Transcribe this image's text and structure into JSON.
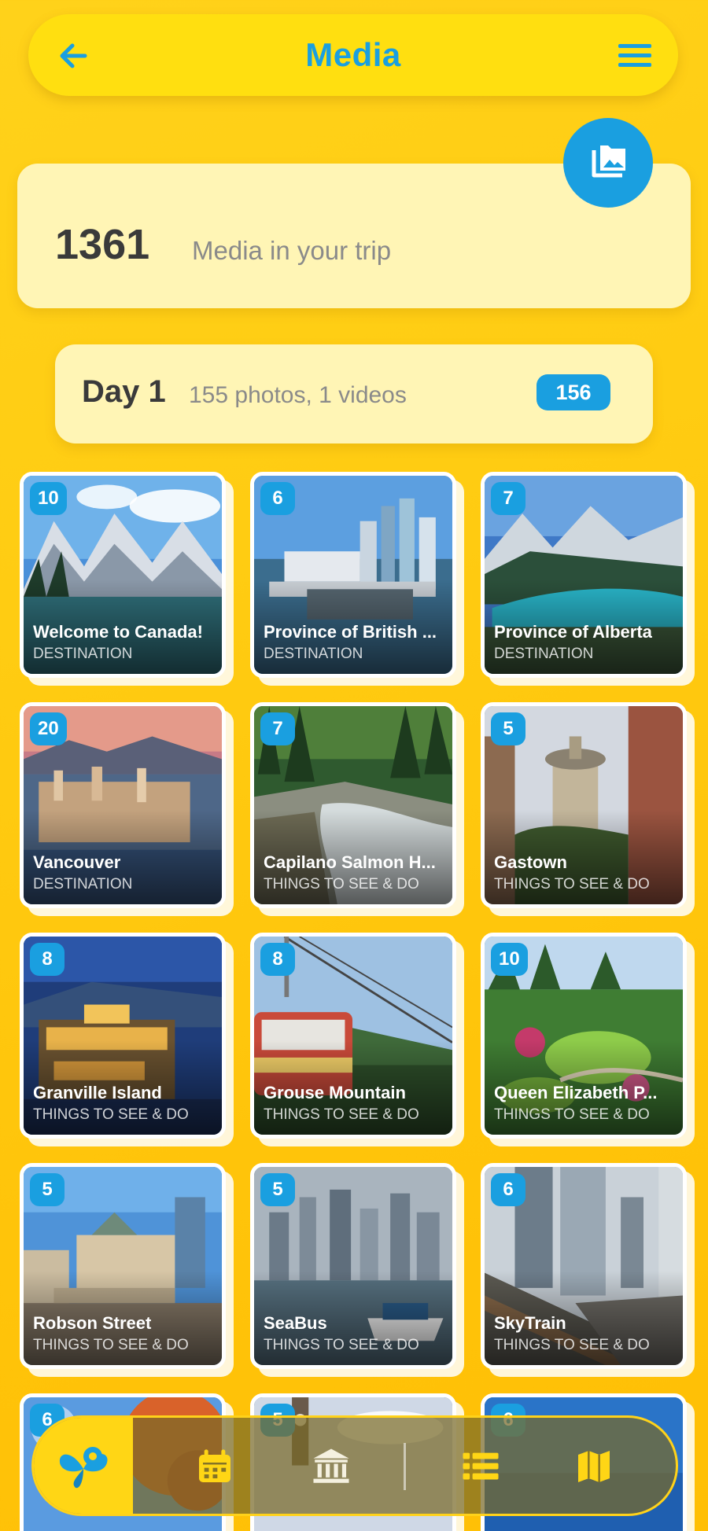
{
  "header": {
    "title": "Media"
  },
  "summary": {
    "count": "1361",
    "label": "Media in your trip"
  },
  "day": {
    "title": "Day 1",
    "subtitle": "155 photos, 1 videos",
    "badge": "156"
  },
  "colors": {
    "accent": "#1a9fe0",
    "header_bg": "#ffdf10",
    "card_bg": "#fff5b5",
    "page_bg": "#ffcc12"
  },
  "tiles": [
    {
      "count": "10",
      "name": "Welcome to Canada!",
      "category": "DESTINATION",
      "scene": "mountain-lake"
    },
    {
      "count": "6",
      "name": "Province of British ...",
      "category": "DESTINATION",
      "scene": "city-harbor"
    },
    {
      "count": "7",
      "name": "Province of Alberta",
      "category": "DESTINATION",
      "scene": "turquoise-lake"
    },
    {
      "count": "20",
      "name": "Vancouver",
      "category": "DESTINATION",
      "scene": "city-sunset"
    },
    {
      "count": "7",
      "name": "Capilano Salmon H...",
      "category": "THINGS TO SEE & DO",
      "scene": "forest-river"
    },
    {
      "count": "5",
      "name": "Gastown",
      "category": "THINGS TO SEE & DO",
      "scene": "tower-street"
    },
    {
      "count": "8",
      "name": "Granville Island",
      "category": "THINGS TO SEE & DO",
      "scene": "night-market"
    },
    {
      "count": "8",
      "name": "Grouse Mountain",
      "category": "THINGS TO SEE & DO",
      "scene": "gondola"
    },
    {
      "count": "10",
      "name": "Queen Elizabeth P...",
      "category": "THINGS TO SEE & DO",
      "scene": "garden"
    },
    {
      "count": "5",
      "name": "Robson Street",
      "category": "THINGS TO SEE & DO",
      "scene": "plaza"
    },
    {
      "count": "5",
      "name": "SeaBus",
      "category": "THINGS TO SEE & DO",
      "scene": "skyline-water"
    },
    {
      "count": "6",
      "name": "SkyTrain",
      "category": "THINGS TO SEE & DO",
      "scene": "towers-rail"
    },
    {
      "count": "6",
      "name": "",
      "category": "",
      "scene": "autumn"
    },
    {
      "count": "5",
      "name": "",
      "category": "",
      "scene": "clock-sky"
    },
    {
      "count": "6",
      "name": "",
      "category": "",
      "scene": "deep-blue"
    }
  ],
  "nav": {
    "items": [
      {
        "icon": "butterfly-pin-icon"
      },
      {
        "icon": "calendar-icon"
      },
      {
        "icon": "museum-icon"
      },
      {
        "icon": "list-icon"
      },
      {
        "icon": "map-icon"
      }
    ]
  }
}
